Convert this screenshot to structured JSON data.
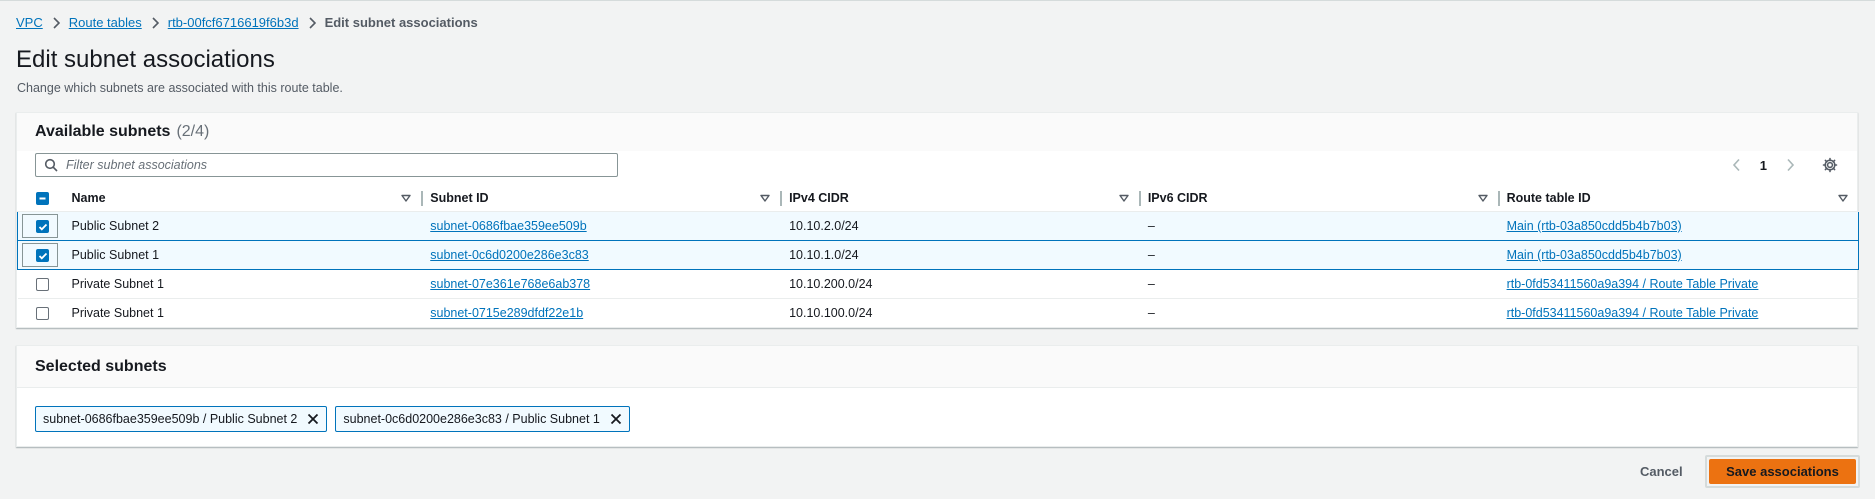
{
  "breadcrumb": {
    "items": [
      "VPC",
      "Route tables",
      "rtb-00fcf6716619f6b3d"
    ],
    "current": "Edit subnet associations"
  },
  "page": {
    "title": "Edit subnet associations",
    "description": "Change which subnets are associated with this route table."
  },
  "available": {
    "title": "Available subnets",
    "count": "(2/4)",
    "filter_placeholder": "Filter subnet associations",
    "page_number": "1",
    "columns": [
      "Name",
      "Subnet ID",
      "IPv4 CIDR",
      "IPv6 CIDR",
      "Route table ID"
    ],
    "rows": [
      {
        "checked": true,
        "name": "Public Subnet 2",
        "subnet_id": "subnet-0686fbae359ee509b",
        "ipv4": "10.10.2.0/24",
        "ipv6": "–",
        "route_table": "Main (rtb-03a850cdd5b4b7b03)"
      },
      {
        "checked": true,
        "name": "Public Subnet 1",
        "subnet_id": "subnet-0c6d0200e286e3c83",
        "ipv4": "10.10.1.0/24",
        "ipv6": "–",
        "route_table": "Main (rtb-03a850cdd5b4b7b03)"
      },
      {
        "checked": false,
        "name": "Private Subnet 1",
        "subnet_id": "subnet-07e361e768e6ab378",
        "ipv4": "10.10.200.0/24",
        "ipv6": "–",
        "route_table": "rtb-0fd53411560a9a394 / Route Table Private"
      },
      {
        "checked": false,
        "name": "Private Subnet 1",
        "subnet_id": "subnet-0715e289dfdf22e1b",
        "ipv4": "10.10.100.0/24",
        "ipv6": "–",
        "route_table": "rtb-0fd53411560a9a394 / Route Table Private"
      }
    ]
  },
  "selected": {
    "title": "Selected subnets",
    "tokens": [
      "subnet-0686fbae359ee509b / Public Subnet 2",
      "subnet-0c6d0200e286e3c83 / Public Subnet 1"
    ]
  },
  "footer": {
    "cancel_label": "Cancel",
    "save_label": "Save associations"
  },
  "colors": {
    "link": "#0073bb",
    "primary_button": "#ec7211",
    "selected_row": "#f1faff"
  },
  "icons": [
    "chevron-right-icon",
    "search-icon",
    "chevron-left-icon",
    "settings-gear-icon",
    "sort-caret-icon",
    "close-icon"
  ]
}
